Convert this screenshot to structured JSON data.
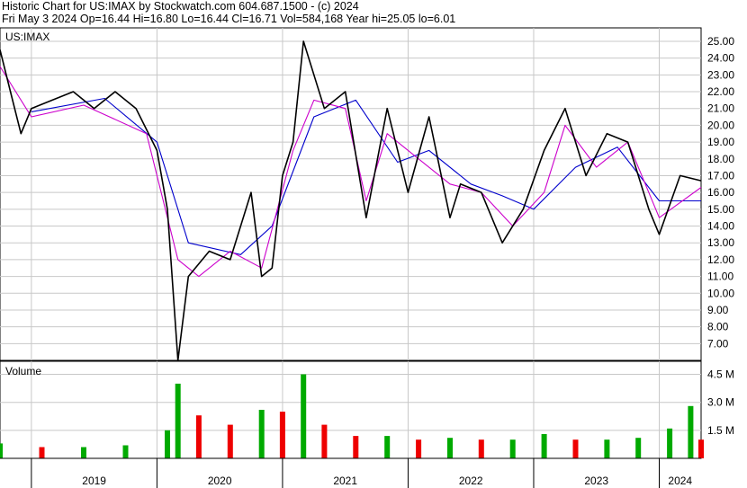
{
  "header": {
    "line1": "Historic Chart for US:IMAX by Stockwatch.com 604.687.1500 - (c) 2024",
    "line2": "Fri May  3 2024   Op=16.44   Hi=16.80   Lo=16.44   Cl=16.71   Vol=584,168   Year hi=25.05   lo=6.01"
  },
  "chart_data": [
    {
      "type": "line",
      "title": "US:IMAX",
      "y_axis": {
        "ticks": [
          "25.00",
          "24.00",
          "23.00",
          "22.00",
          "21.00",
          "20.00",
          "19.00",
          "18.00",
          "17.00",
          "16.00",
          "15.00",
          "14.00",
          "13.00",
          "12.00",
          "11.00",
          "10.00",
          "9.00",
          "8.00",
          "7.00"
        ],
        "ylim": [
          6.0,
          25.8
        ]
      },
      "x_axis": {
        "labels": [
          "2019",
          "2020",
          "2021",
          "2022",
          "2023",
          "2024"
        ],
        "range": [
          "2018-10",
          "2024-05"
        ]
      },
      "grid": true,
      "colors": {
        "price": "#000000",
        "ma_short": "#cc00cc",
        "ma_long": "#0000cc"
      },
      "series": [
        {
          "role": "price",
          "x": [
            "2018-10",
            "2018-11",
            "2018-12",
            "2019-01",
            "2019-03",
            "2019-05",
            "2019-07",
            "2019-09",
            "2019-11",
            "2020-01",
            "2020-02",
            "2020-03",
            "2020-04",
            "2020-06",
            "2020-08",
            "2020-10",
            "2020-11",
            "2020-12",
            "2021-01",
            "2021-02",
            "2021-03",
            "2021-05",
            "2021-07",
            "2021-09",
            "2021-11",
            "2022-01",
            "2022-03",
            "2022-05",
            "2022-06",
            "2022-08",
            "2022-10",
            "2022-12",
            "2023-02",
            "2023-04",
            "2023-06",
            "2023-08",
            "2023-10",
            "2023-12",
            "2024-01",
            "2024-03",
            "2024-05"
          ],
          "values": [
            24.5,
            22.0,
            19.5,
            21.0,
            21.5,
            22.0,
            21.0,
            22.0,
            21.0,
            18.5,
            15.0,
            6.0,
            11.0,
            12.5,
            12.0,
            16.0,
            11.0,
            11.5,
            17.0,
            19.0,
            25.0,
            21.0,
            22.0,
            14.5,
            21.0,
            16.0,
            20.5,
            14.5,
            16.5,
            16.0,
            13.0,
            15.0,
            18.5,
            21.0,
            17.0,
            19.5,
            19.0,
            15.0,
            13.5,
            17.0,
            16.7
          ]
        },
        {
          "role": "ma_short",
          "x": [
            "2018-10",
            "2019-01",
            "2019-06",
            "2019-12",
            "2020-03",
            "2020-05",
            "2020-08",
            "2020-11",
            "2021-02",
            "2021-04",
            "2021-07",
            "2021-09",
            "2021-11",
            "2022-02",
            "2022-05",
            "2022-08",
            "2022-11",
            "2023-02",
            "2023-04",
            "2023-07",
            "2023-10",
            "2024-01",
            "2024-05"
          ],
          "values": [
            23.5,
            20.5,
            21.2,
            19.5,
            12.0,
            11.0,
            12.5,
            11.5,
            18.5,
            21.5,
            21.0,
            15.5,
            19.5,
            18.0,
            16.5,
            16.0,
            14.0,
            16.0,
            20.0,
            17.5,
            19.0,
            14.5,
            16.3
          ]
        },
        {
          "role": "ma_long",
          "x": [
            "2019-01",
            "2019-08",
            "2020-01",
            "2020-04",
            "2020-09",
            "2020-12",
            "2021-04",
            "2021-08",
            "2021-12",
            "2022-03",
            "2022-07",
            "2022-10",
            "2023-01",
            "2023-05",
            "2023-09",
            "2024-01",
            "2024-05"
          ],
          "values": [
            20.8,
            21.6,
            19.0,
            13.0,
            12.3,
            14.0,
            20.5,
            21.5,
            17.8,
            18.5,
            16.5,
            15.8,
            15.0,
            17.5,
            18.7,
            15.5,
            15.5
          ]
        }
      ]
    },
    {
      "type": "bar",
      "title": "Volume",
      "y_axis": {
        "ticks": [
          "4.5 M",
          "3.0 M",
          "1.5 M"
        ],
        "ylim": [
          0,
          5.2
        ]
      },
      "unit": "M",
      "colors": {
        "up": "#00aa00",
        "down": "#ee0000"
      },
      "x": [
        "2018-10",
        "2019-02",
        "2019-06",
        "2019-10",
        "2020-02",
        "2020-03",
        "2020-05",
        "2020-08",
        "2020-11",
        "2021-01",
        "2021-03",
        "2021-05",
        "2021-08",
        "2021-11",
        "2022-02",
        "2022-05",
        "2022-08",
        "2022-11",
        "2023-02",
        "2023-05",
        "2023-08",
        "2023-11",
        "2024-02",
        "2024-04",
        "2024-05"
      ],
      "values": [
        0.8,
        0.6,
        0.6,
        0.7,
        1.5,
        4.0,
        2.3,
        1.8,
        2.6,
        2.5,
        4.5,
        1.8,
        1.2,
        1.2,
        1.0,
        1.1,
        1.0,
        1.0,
        1.3,
        1.0,
        1.0,
        1.1,
        1.6,
        2.8,
        1.0
      ]
    }
  ]
}
